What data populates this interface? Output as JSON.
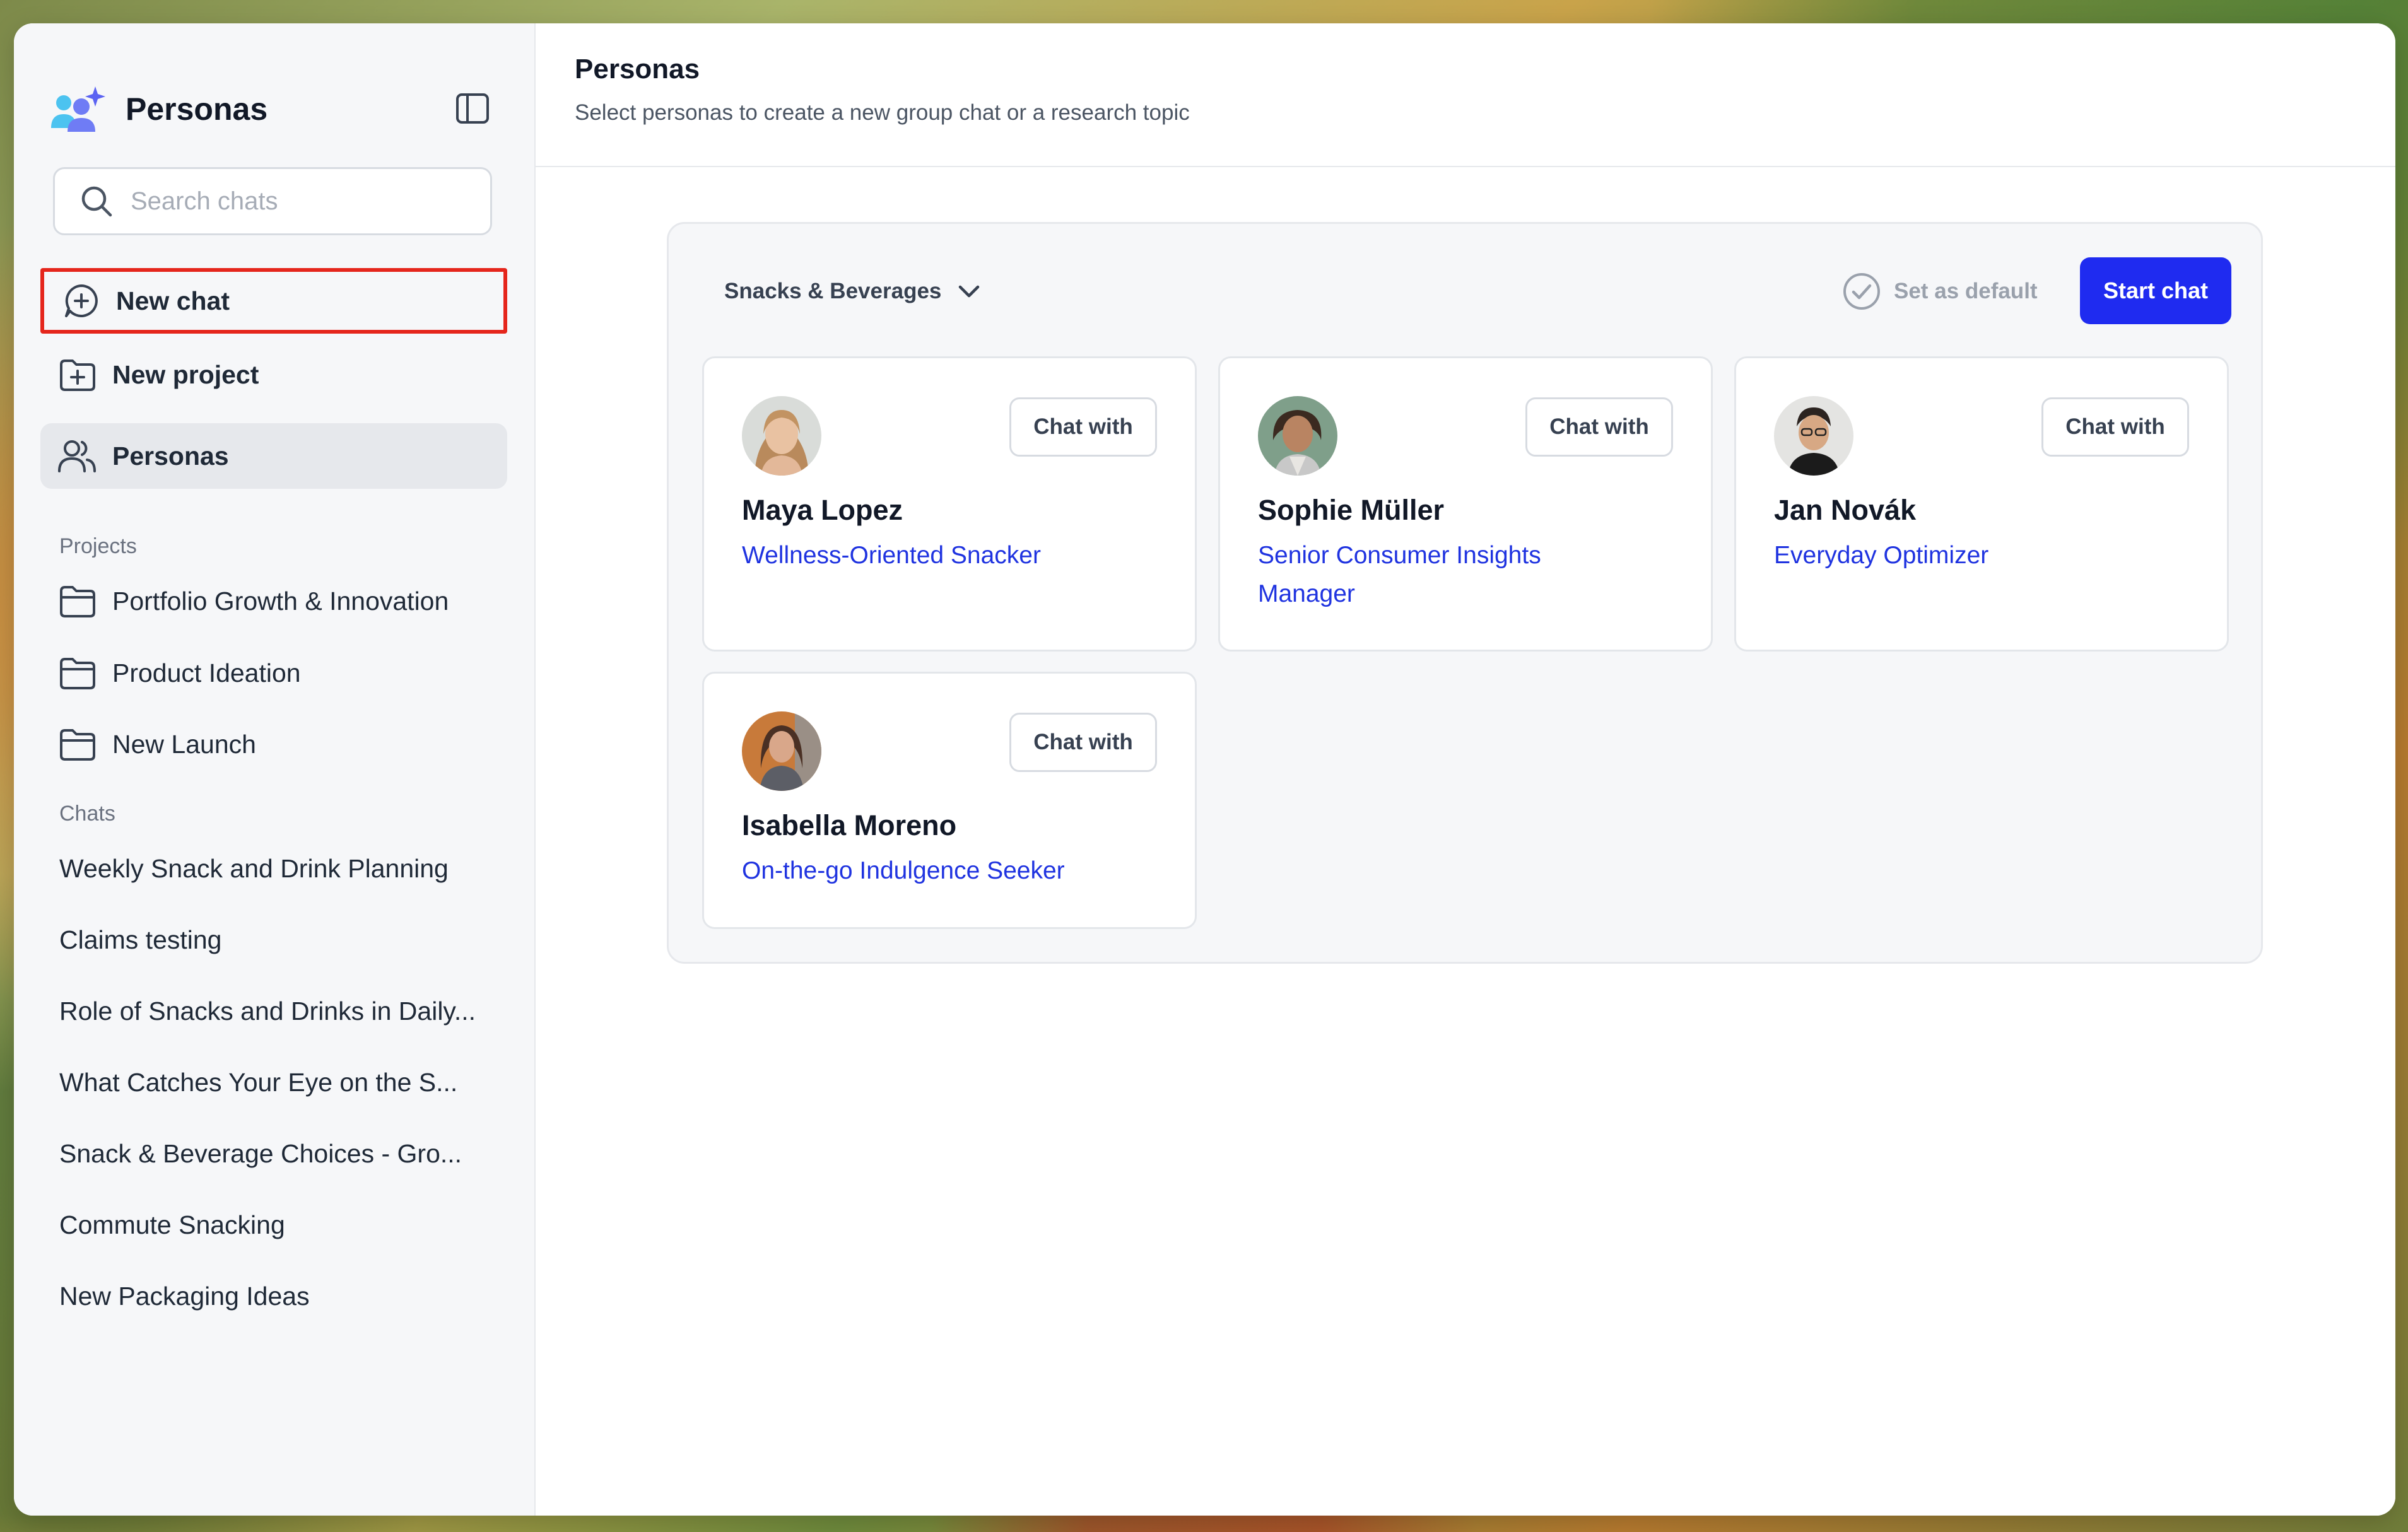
{
  "app": {
    "brand_title": "Personas",
    "accent_color": "#1f2bf0",
    "link_color": "#1f33e0",
    "highlight_color": "#e5261c"
  },
  "sidebar": {
    "search_placeholder": "Search chats",
    "nav": [
      {
        "label": "New chat",
        "icon": "chat-plus-icon"
      },
      {
        "label": "New project",
        "icon": "folder-plus-icon"
      },
      {
        "label": "Personas",
        "icon": "users-icon"
      }
    ],
    "projects_label": "Projects",
    "projects": [
      {
        "label": "Portfolio Growth & Innovation",
        "icon": "folder-icon"
      },
      {
        "label": "Product Ideation",
        "icon": "folder-icon"
      },
      {
        "label": "New Launch",
        "icon": "folder-icon"
      }
    ],
    "chats_label": "Chats",
    "chats": [
      "Weekly Snack and Drink Planning",
      "Claims testing",
      "Role of Snacks and Drinks in Daily...",
      "What Catches Your Eye on the S...",
      "Snack & Beverage Choices - Gro...",
      "Commute Snacking",
      "New Packaging Ideas"
    ]
  },
  "main": {
    "title": "Personas",
    "subtitle": "Select personas to create a new group chat or a research topic",
    "category_dropdown": "Snacks & Beverages",
    "set_default_label": "Set as default",
    "start_chat_label": "Start chat",
    "chat_with_label": "Chat with",
    "personas": [
      {
        "name": "Maya Lopez",
        "role": "Wellness-Oriented Snacker"
      },
      {
        "name": "Sophie Müller",
        "role": "Senior Consumer Insights Manager"
      },
      {
        "name": "Jan Novák",
        "role": "Everyday Optimizer"
      },
      {
        "name": "Isabella Moreno",
        "role": "On-the-go Indulgence Seeker"
      }
    ]
  }
}
